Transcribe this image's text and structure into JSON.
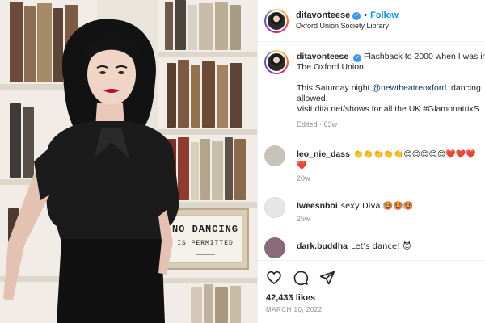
{
  "post": {
    "username": "ditavonteese",
    "follow_label": "Follow",
    "separator": "•",
    "location": "Oxford Union Society Library"
  },
  "sign": {
    "line1": "NO DANCING",
    "line2": "IS PERMITTED"
  },
  "caption": {
    "username": "ditavonteese",
    "line1": "Flashback to 2000 when I was inv",
    "line2": "The Oxford Union.",
    "line3_prefix": "This Saturday night ",
    "line3_mention": "@newtheatreoxford",
    "line3_suffix": ". dancing",
    "line4": "allowed.",
    "line5": "Visit dita.net/shows for all the UK #GlamonatrixS",
    "edited": "Edited · 63w"
  },
  "comments": [
    {
      "username": "leo_nie_dass",
      "text": "👏👏👏👏👏😍😍😍😍😍❤️❤️❤️",
      "text_line2": "❤️",
      "meta": "20w",
      "avatar_color": "#c9c2b8"
    },
    {
      "username": "lweesnboi",
      "text": "sexy Diva 🥵🥵🥵",
      "meta": "25w",
      "avatar_color": "#e6e6e6"
    },
    {
      "username": "dark.buddha",
      "text": "Let's dance! 😈",
      "meta": "",
      "avatar_color": "#8a6a78"
    }
  ],
  "actions": {
    "like_icon": "heart-icon",
    "comment_icon": "comment-icon",
    "share_icon": "share-icon",
    "likes": "42,433 likes",
    "date": "MARCH 10, 2022"
  },
  "colors": {
    "accent": "#0095f6",
    "verified": "#3897f0",
    "muted": "#8e8e8e",
    "mention": "#00376b"
  }
}
